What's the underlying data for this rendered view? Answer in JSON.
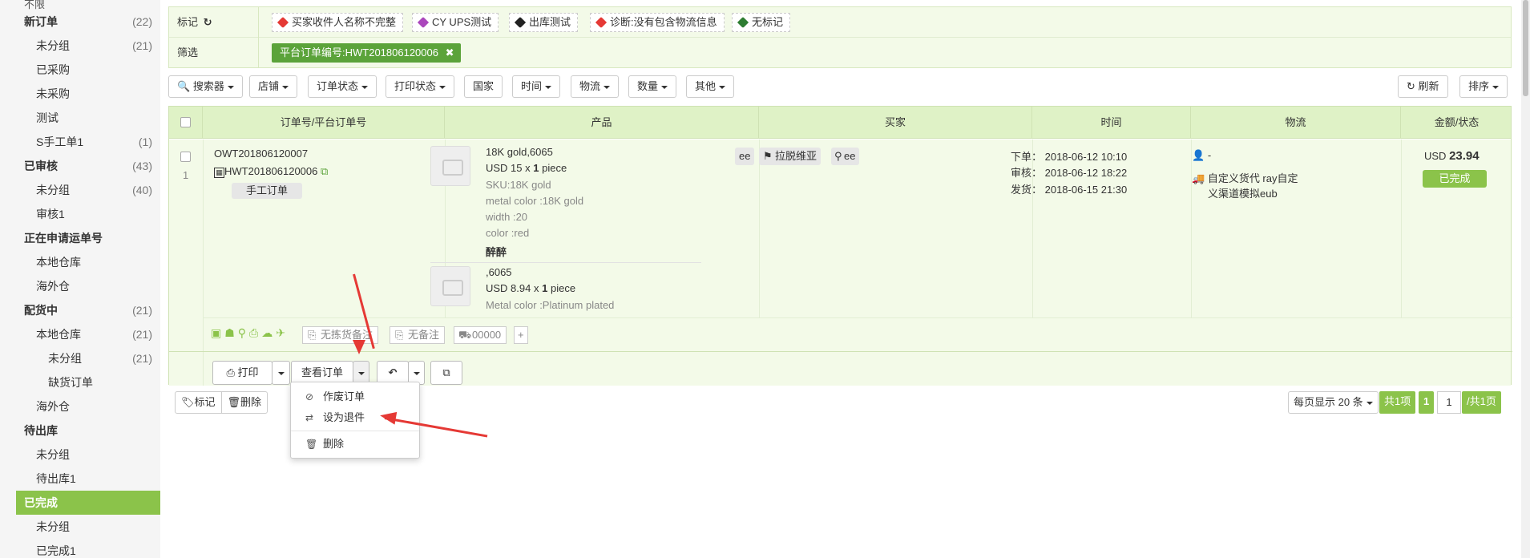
{
  "sidebar": {
    "top_cut": "不限",
    "items": [
      {
        "label": "新订单",
        "count": "(22)",
        "level": 1
      },
      {
        "label": "未分组",
        "count": "(21)",
        "level": 2
      },
      {
        "label": "已采购",
        "count": "",
        "level": 2
      },
      {
        "label": "未采购",
        "count": "",
        "level": 2
      },
      {
        "label": "测试",
        "count": "",
        "level": 2
      },
      {
        "label": "S手工单1",
        "count": "(1)",
        "level": 2
      },
      {
        "label": "已审核",
        "count": "(43)",
        "level": 1
      },
      {
        "label": "未分组",
        "count": "(40)",
        "level": 2
      },
      {
        "label": "审核1",
        "count": "",
        "level": 2
      },
      {
        "label": "正在申请运单号",
        "count": "",
        "level": 1
      },
      {
        "label": "本地仓库",
        "count": "",
        "level": 2
      },
      {
        "label": "海外仓",
        "count": "",
        "level": 2
      },
      {
        "label": "配货中",
        "count": "(21)",
        "level": 1
      },
      {
        "label": "本地仓库",
        "count": "(21)",
        "level": 2
      },
      {
        "label": "未分组",
        "count": "(21)",
        "level": 3
      },
      {
        "label": "缺货订单",
        "count": "",
        "level": 3
      },
      {
        "label": "海外仓",
        "count": "",
        "level": 2
      },
      {
        "label": "待出库",
        "count": "",
        "level": 1
      },
      {
        "label": "未分组",
        "count": "",
        "level": 2
      },
      {
        "label": "待出库1",
        "count": "",
        "level": 2
      },
      {
        "label": "已完成",
        "count": "",
        "level": 1,
        "active": true
      },
      {
        "label": "未分组",
        "count": "",
        "level": 2
      },
      {
        "label": "已完成1",
        "count": "",
        "level": 2
      }
    ]
  },
  "filter": {
    "mark_label": "标记",
    "tags": [
      {
        "label": "买家收件人名称不完整",
        "color": "#e53935"
      },
      {
        "label": "CY UPS测试",
        "color": "#ab47bc"
      },
      {
        "label": "出库测试",
        "color": "#222222"
      },
      {
        "label": "诊断:没有包含物流信息",
        "color": "#e53935"
      },
      {
        "label": "无标记",
        "color": "#2e7d32"
      }
    ],
    "filter_label": "筛选",
    "active_chip": "平台订单编号:HWT201806120006"
  },
  "toolbar": {
    "buttons": [
      "搜索器",
      "店铺",
      "订单状态",
      "打印状态",
      "国家",
      "时间",
      "物流",
      "数量",
      "其他"
    ],
    "refresh": "刷新",
    "sort": "排序"
  },
  "table": {
    "headers": [
      "订单号/平台订单号",
      "产品",
      "买家",
      "时间",
      "物流",
      "金额/状态"
    ],
    "row": {
      "index": "1",
      "order_no": "OWT201806120007",
      "platform_no": "HWT201806120006",
      "manual_tag": "手工订单",
      "products": [
        {
          "name": "18K gold,6065",
          "price": "USD 15",
          "qty": "1",
          "unit": "piece",
          "attrs": [
            "SKU:18K gold",
            "metal color :18K gold",
            "width :20",
            "color :red"
          ],
          "note": "醉醉"
        },
        {
          "name": ",6065",
          "price": "USD 8.94",
          "qty": "1",
          "unit": "piece",
          "attrs": [
            "Metal color :Platinum plated"
          ],
          "note": ""
        }
      ],
      "buyer_tags": [
        "ee",
        "拉脱维亚",
        "ee"
      ],
      "times": {
        "order": "下单： 2018-06-12 10:10",
        "audit": "审核： 2018-06-12 18:22",
        "ship": "发货： 2018-06-15 21:30"
      },
      "logistics": {
        "person": "-",
        "channel_line1": "自定义货代 ray自定",
        "channel_line2": "义渠道模拟eub"
      },
      "amount_prefix": "USD",
      "amount": "23.94",
      "status": "已完成",
      "footer": {
        "pick_note": "无拣货备注",
        "note": "无备注",
        "tracking": "00000",
        "add": "+"
      }
    },
    "actions": {
      "print": "打印",
      "view": "查看订单"
    }
  },
  "dropdown": {
    "items": [
      {
        "icon": "⊘",
        "label": "作废订单"
      },
      {
        "icon": "⇄",
        "label": "设为退件"
      },
      {
        "icon": "🗑",
        "label": "删除"
      }
    ]
  },
  "bottom": {
    "mark": "标记",
    "delete": "删除",
    "per_page": "每页显示 20 条",
    "total": "共1项",
    "page": "1",
    "page_input": "1",
    "total_pages": "/共1页"
  }
}
